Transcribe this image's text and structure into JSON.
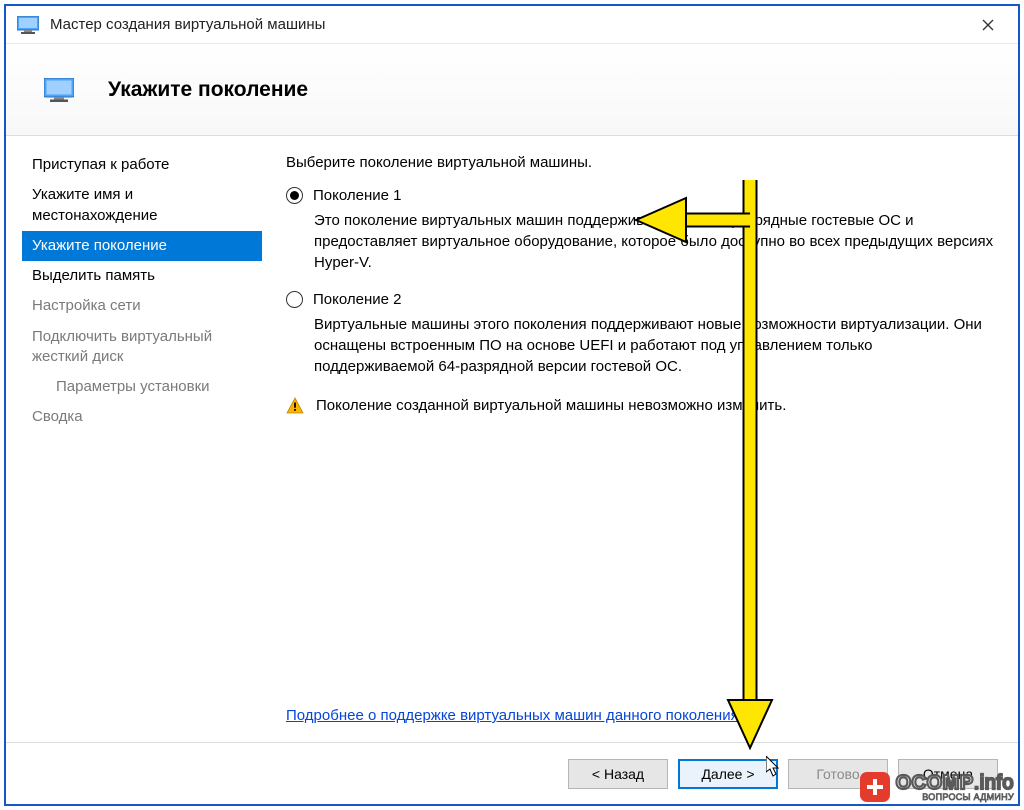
{
  "window": {
    "title": "Мастер создания виртуальной машины"
  },
  "header": {
    "title": "Укажите поколение"
  },
  "sidebar": {
    "steps": [
      {
        "label": "Приступая к работе",
        "enabled": true,
        "active": false,
        "indent": false
      },
      {
        "label": "Укажите имя и местонахождение",
        "enabled": true,
        "active": false,
        "indent": false
      },
      {
        "label": "Укажите поколение",
        "enabled": true,
        "active": true,
        "indent": false
      },
      {
        "label": "Выделить память",
        "enabled": true,
        "active": false,
        "indent": false
      },
      {
        "label": "Настройка сети",
        "enabled": false,
        "active": false,
        "indent": false
      },
      {
        "label": "Подключить виртуальный жесткий диск",
        "enabled": false,
        "active": false,
        "indent": false
      },
      {
        "label": "Параметры установки",
        "enabled": false,
        "active": false,
        "indent": true
      },
      {
        "label": "Сводка",
        "enabled": false,
        "active": false,
        "indent": false
      }
    ]
  },
  "main": {
    "instruction": "Выберите поколение виртуальной машины.",
    "options": [
      {
        "label": "Поколение 1",
        "checked": true,
        "description": "Это поколение виртуальных машин поддерживает 32- и 64-разрядные гостевые ОС и предоставляет виртуальное оборудование, которое было доступно во всех предыдущих версиях Hyper-V."
      },
      {
        "label": "Поколение 2",
        "checked": false,
        "description": "Виртуальные машины этого поколения поддерживают новые возможности виртуализации. Они оснащены встроенным ПО на основе UEFI и работают под управлением только поддерживаемой 64-разрядной версии гостевой ОС."
      }
    ],
    "warning": "Поколение созданной виртуальной машины невозможно изменить.",
    "more_link": "Подробнее о поддержке виртуальных машин данного поколения"
  },
  "footer": {
    "back": "< Назад",
    "next": "Далее >",
    "finish": "Готово",
    "cancel": "Отмена"
  },
  "watermark": {
    "brand": "OCOMP",
    "suffix": ".info",
    "tagline": "ВОПРОСЫ АДМИНУ"
  },
  "colors": {
    "accent": "#0078d7",
    "link": "#0645d8",
    "border": "#1258c9"
  }
}
